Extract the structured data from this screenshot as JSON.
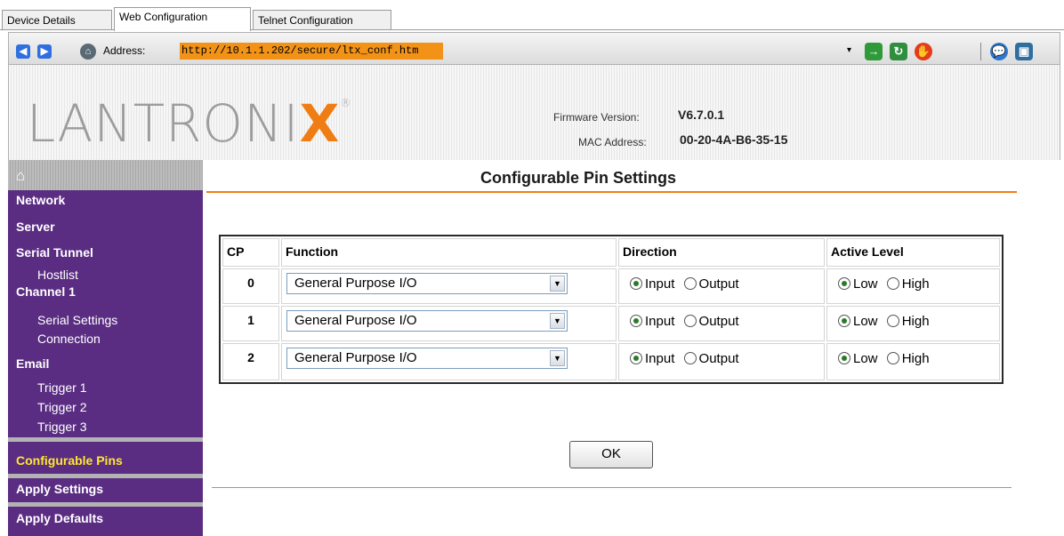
{
  "tabs": [
    "Device Details",
    "Web Configuration",
    "Telnet Configuration"
  ],
  "address_bar": {
    "label": "Address:",
    "url": "http://10.1.1.202/secure/ltx_conf.htm"
  },
  "header": {
    "logo_main": "LANTRONI",
    "logo_x": "X",
    "logo_reg": "®",
    "firmware_label": "Firmware Version:",
    "firmware_value": "V6.7.0.1",
    "mac_label": "MAC Address:",
    "mac_value": "00-20-4A-B6-35-15"
  },
  "sidebar": {
    "home_icon": "⌂",
    "items": [
      {
        "label": "Network",
        "level": 0
      },
      {
        "label": "Server",
        "level": 0
      },
      {
        "label": "Serial Tunnel",
        "level": 0
      },
      {
        "label": "Hostlist",
        "level": 1
      },
      {
        "label": "Channel 1",
        "level": 0
      },
      {
        "label": "Serial Settings",
        "level": 1
      },
      {
        "label": "Connection",
        "level": 1
      },
      {
        "label": "Email",
        "level": 0
      },
      {
        "label": "Trigger 1",
        "level": 1
      },
      {
        "label": "Trigger 2",
        "level": 1
      },
      {
        "label": "Trigger 3",
        "level": 1
      },
      {
        "label": "Configurable Pins",
        "level": 0,
        "active": true
      },
      {
        "label": "Apply Settings",
        "level": 0
      },
      {
        "label": "Apply Defaults",
        "level": 0
      }
    ]
  },
  "main": {
    "title": "Configurable Pin Settings",
    "columns": [
      "CP",
      "Function",
      "Direction",
      "Active Level"
    ],
    "rows": [
      {
        "cp": "0",
        "function": "General Purpose I/O",
        "direction": "Input",
        "level": "Low"
      },
      {
        "cp": "1",
        "function": "General Purpose I/O",
        "direction": "Input",
        "level": "Low"
      },
      {
        "cp": "2",
        "function": "General Purpose I/O",
        "direction": "Input",
        "level": "Low"
      }
    ],
    "direction_options": [
      "Input",
      "Output"
    ],
    "level_options": [
      "Low",
      "High"
    ],
    "ok_label": "OK"
  },
  "colors": {
    "sidebar": "#5a2d82",
    "accent": "#f07d14",
    "active_nav": "#ffe82f"
  }
}
